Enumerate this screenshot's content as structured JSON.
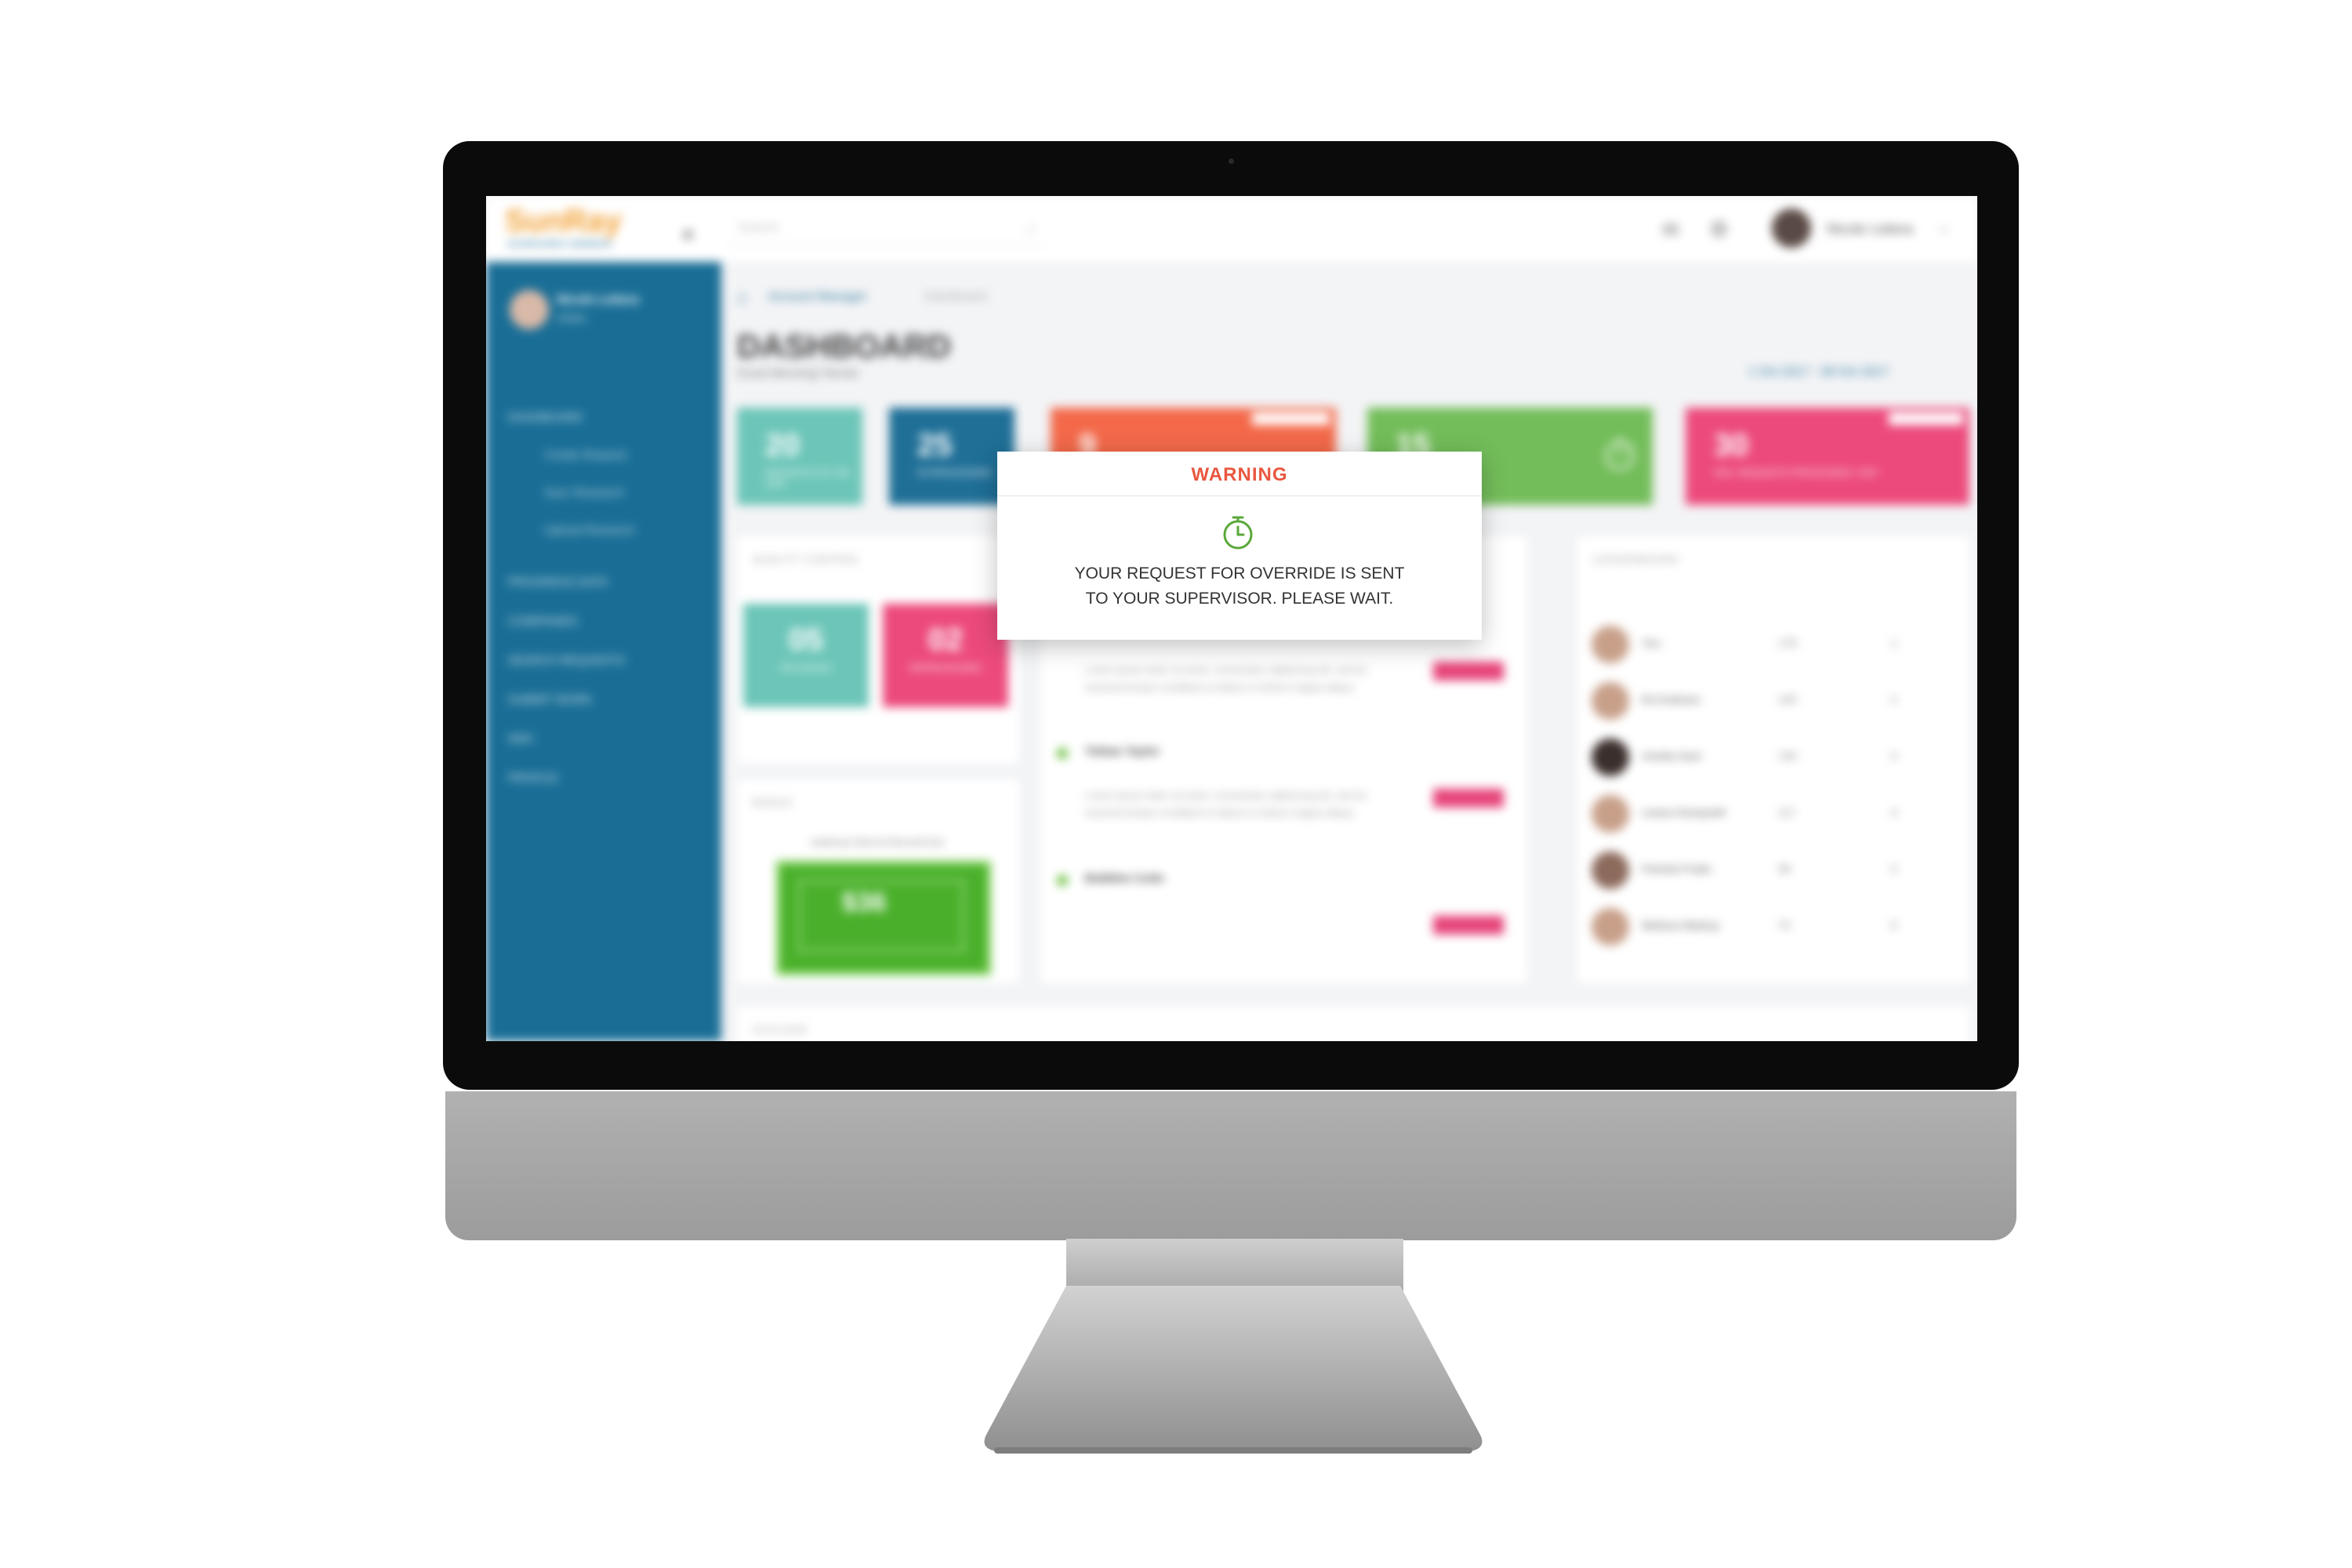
{
  "app": {
    "logo": "SunRay",
    "logo_sub": "construction solutions",
    "search_placeholder": "Search",
    "user_name": "Nicole Leitera"
  },
  "sidebar": {
    "user_name": "Nicole Leitera",
    "user_status": "Online",
    "items": [
      {
        "label": "DASHBOARD"
      },
      {
        "label": "Create Request"
      },
      {
        "label": "Sync Research"
      },
      {
        "label": "Upload Research"
      },
      {
        "label": "PROGRESS DATA"
      },
      {
        "label": "COMPANIES"
      },
      {
        "label": "SEARCH REQUESTS"
      },
      {
        "label": "SUBMIT WORK"
      },
      {
        "label": "WIKI"
      },
      {
        "label": "PROFILE"
      }
    ]
  },
  "main": {
    "breadcrumb": [
      "Account Manager",
      "Dashboard"
    ],
    "title": "DASHBOARD",
    "greeting": "Good Morning! Nicole",
    "date_range": "1 Oct 2017 - 08 Oct 2017",
    "stats": [
      {
        "value": "20",
        "label": "REQUESTS IN THE QUE",
        "color": "#6cc5b8"
      },
      {
        "value": "25",
        "label": "IN PROCESSING",
        "color": "#1f6f97"
      },
      {
        "value": "9",
        "label": "",
        "tag": "HIGH PRIORITY",
        "color": "#f3694a"
      },
      {
        "value": "15",
        "label": "",
        "color": "#73bd5a"
      },
      {
        "value": "30",
        "label": "AVG. REQUESTS PROCESSED / DAY",
        "tag": "OUTSTANDING",
        "color": "#ec4a7c"
      }
    ],
    "quality_control": {
      "title": "QUALITY CONTROL",
      "items": [
        {
          "value": "05",
          "label": "REVISIONS",
          "color": "#6cc5b8"
        },
        {
          "value": "02",
          "label": "REPROCESSED",
          "color": "#ec4a7c"
        }
      ]
    },
    "bonus": {
      "title": "BONUS",
      "caption": "EARN $1 PER EXTRA NOTICE",
      "amount": "$36"
    },
    "activity": [
      {
        "name": "Tobias Taylor",
        "target": "Restaurant Job",
        "text": "Lorem ipsum dolor sit amet, consectetur adipiscing elit, sed do eiusmod tempor incididunt ut labore et dolore magna aliqua."
      },
      {
        "name": "Bubbles Cutie",
        "target": "Some Job",
        "text": "Lorem ipsum dolor sit amet, consectetur adipiscing elit, sed do eiusmod tempor incididunt ut labore et dolore magna aliqua."
      }
    ],
    "leaderboard": {
      "title": "LEADERBOARD",
      "rows": [
        {
          "name": "You",
          "points": "178",
          "rank": "1"
        },
        {
          "name": "Ed Andrews",
          "points": "145",
          "rank": "2"
        },
        {
          "name": "Amelia Gani",
          "points": "130",
          "rank": "3"
        },
        {
          "name": "Leesa Honeywell",
          "points": "117",
          "rank": "4"
        },
        {
          "name": "Pamela Prado",
          "points": "98",
          "rank": "5"
        },
        {
          "name": "Melissa Madrup",
          "points": "70",
          "rank": "6"
        }
      ]
    },
    "outlook_title": "OUTLOOK"
  },
  "modal": {
    "title": "WARNING",
    "icon": "stopwatch-icon",
    "line1": "YOUR REQUEST FOR OVERRIDE IS SENT",
    "line2": "TO YOUR SUPERVISOR. PLEASE WAIT.",
    "title_color": "#e9573f",
    "icon_color": "#5aa83a"
  }
}
